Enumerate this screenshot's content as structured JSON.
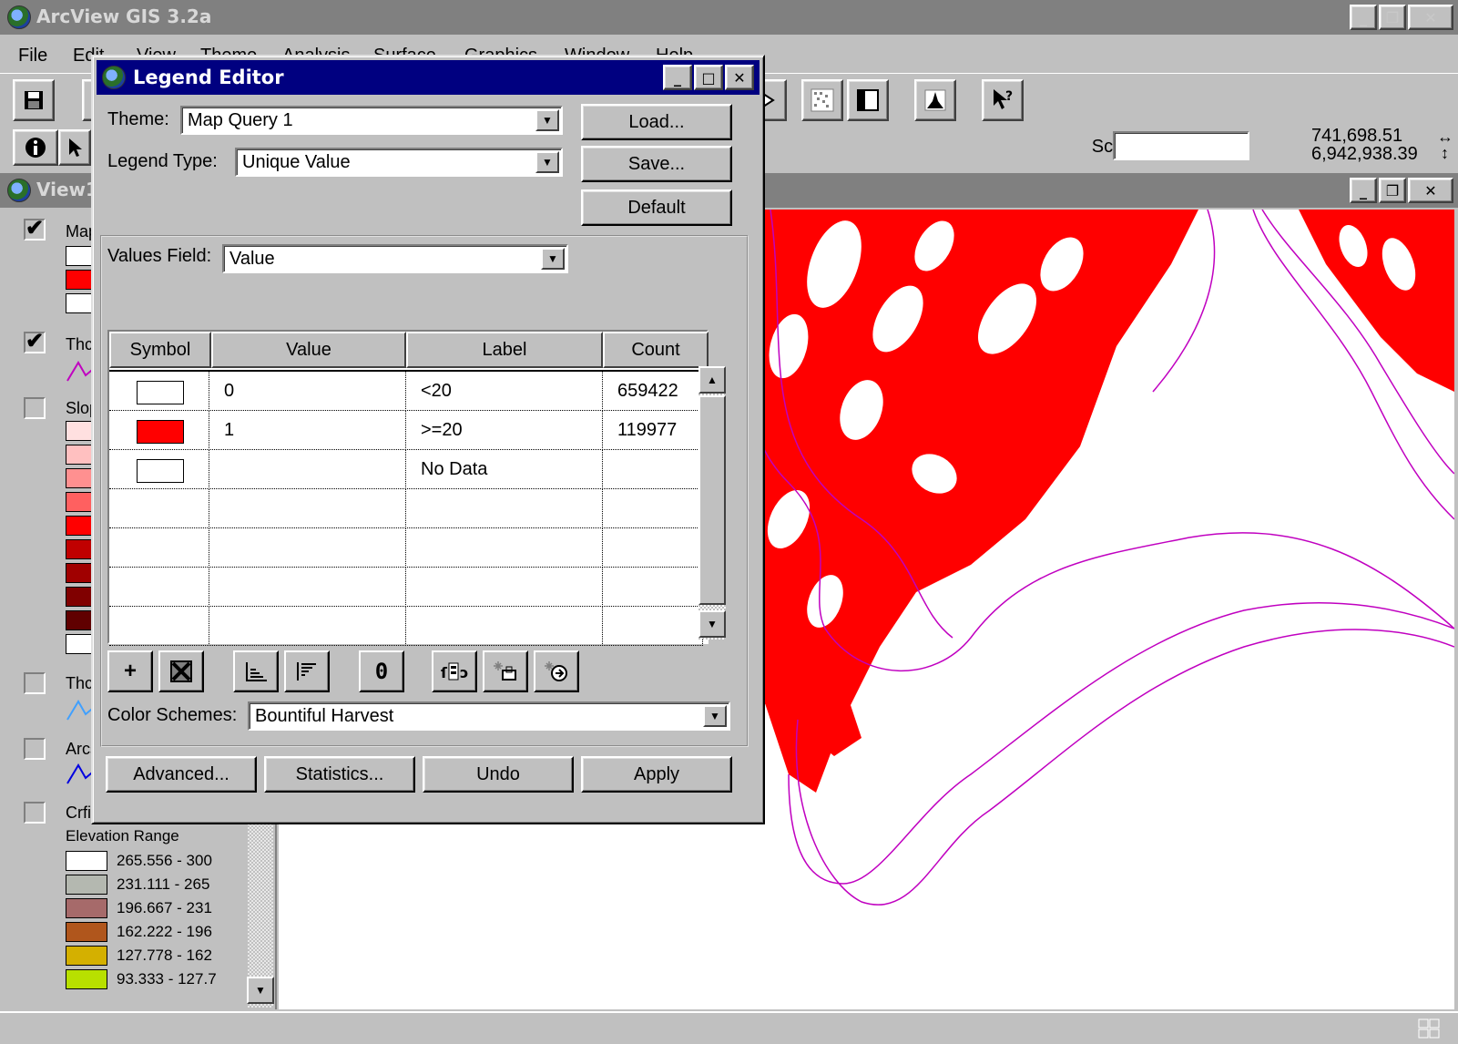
{
  "app": {
    "title": "ArcView GIS 3.2a",
    "menu": [
      "File",
      "Edit",
      "View",
      "Theme",
      "Analysis",
      "Surface",
      "Graphics",
      "Window",
      "Help"
    ]
  },
  "scale": {
    "label": "Scale 1:",
    "value": ""
  },
  "coords": {
    "x": "741,698.51",
    "y": "6,942,938.39"
  },
  "view": {
    "title": "View1"
  },
  "toc": {
    "themes": [
      {
        "name": "Map Query 1",
        "checked": true
      },
      {
        "name": "Thcontour",
        "checked": true
      },
      {
        "name": "Slope",
        "checked": false
      },
      {
        "name": "Thcontour",
        "checked": false
      },
      {
        "name": "Arcs",
        "checked": false
      },
      {
        "name": "Crfin2",
        "checked": false
      }
    ],
    "elevation_title": "Elevation Range",
    "elevation_ranges": [
      {
        "label": "265.556 - 300",
        "color": "#ffffff"
      },
      {
        "label": "231.111 - 265",
        "color": "#b4b8b0"
      },
      {
        "label": "196.667 - 231",
        "color": "#a66a6a"
      },
      {
        "label": "162.222 - 196",
        "color": "#b0561c"
      },
      {
        "label": "127.778 - 162",
        "color": "#d4b000"
      },
      {
        "label": "93.333 - 127.7",
        "color": "#b8e000"
      }
    ]
  },
  "legend_editor": {
    "title": "Legend Editor",
    "theme_label": "Theme:",
    "theme_value": "Map Query 1",
    "legend_type_label": "Legend Type:",
    "legend_type_value": "Unique Value",
    "values_field_label": "Values Field:",
    "values_field_value": "Value",
    "color_schemes_label": "Color Schemes:",
    "color_schemes_value": "Bountiful Harvest",
    "buttons": {
      "load": "Load...",
      "save": "Save...",
      "default": "Default",
      "advanced": "Advanced...",
      "statistics": "Statistics...",
      "undo": "Undo",
      "apply": "Apply"
    },
    "columns": {
      "symbol": "Symbol",
      "value": "Value",
      "label": "Label",
      "count": "Count"
    },
    "rows": [
      {
        "symbol_color": "#ffffff",
        "value": "0",
        "label": "<20",
        "count": "659422"
      },
      {
        "symbol_color": "#ff0000",
        "value": "1",
        "label": ">=20",
        "count": "119977"
      },
      {
        "symbol_color": "#ffffff",
        "value": "",
        "label": "No Data",
        "count": ""
      }
    ],
    "tool_icons": [
      "add-icon",
      "delete-icon",
      "sort-ascending-icon",
      "sort-descending-icon",
      "null-value-icon",
      "query-icon",
      "copy-symbol-icon",
      "paste-symbol-icon"
    ]
  },
  "colors": {
    "map_fill": "#ff0000",
    "contour": "#c000c0",
    "titlebar_active": "#000080",
    "titlebar_inactive": "#808080"
  }
}
